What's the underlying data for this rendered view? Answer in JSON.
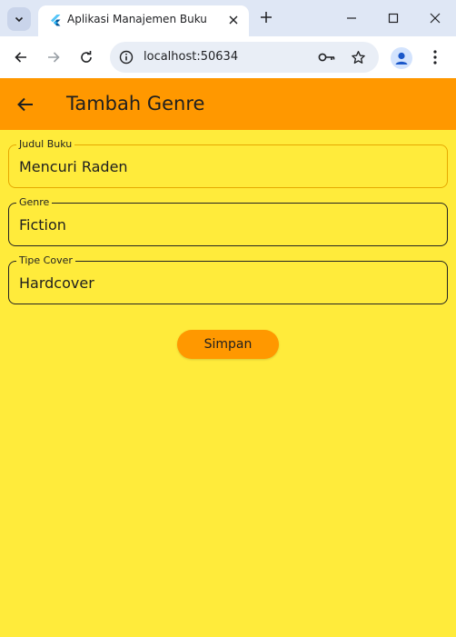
{
  "browser": {
    "tab_title": "Aplikasi Manajemen Buku",
    "url": "localhost:50634"
  },
  "app": {
    "title": "Tambah Genre",
    "fields": [
      {
        "label": "Judul Buku",
        "value": "Mencuri Raden"
      },
      {
        "label": "Genre",
        "value": "Fiction"
      },
      {
        "label": "Tipe Cover",
        "value": "Hardcover"
      }
    ],
    "save_label": "Simpan"
  },
  "colors": {
    "background": "#ffeb3b",
    "app_bar": "#ff9800",
    "button": "#ff9800",
    "focused_border": "#e6a800"
  }
}
